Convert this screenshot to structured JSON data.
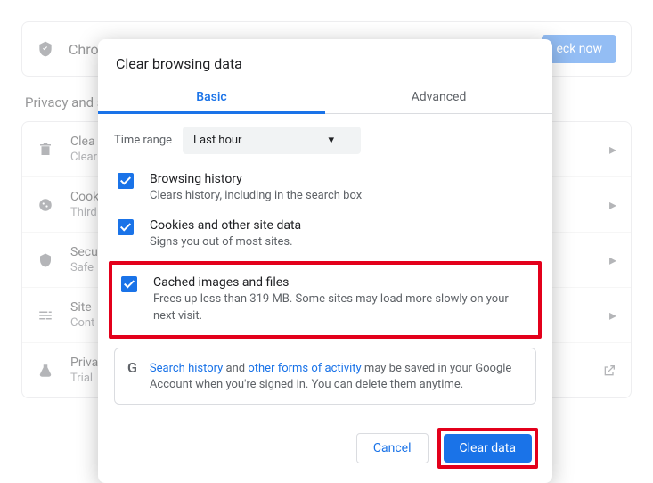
{
  "background": {
    "banner_text": "Chro",
    "check_now": "eck now",
    "section": "Privacy and s",
    "rows": [
      {
        "label": "Clea",
        "sub": "Clear"
      },
      {
        "label": "Cook",
        "sub": "Third"
      },
      {
        "label": "Secu",
        "sub": "Safe"
      },
      {
        "label": "Site",
        "sub": "Cont"
      },
      {
        "label": "Priva",
        "sub": "Trial"
      }
    ]
  },
  "dialog": {
    "title": "Clear browsing data",
    "tabs": {
      "basic": "Basic",
      "advanced": "Advanced"
    },
    "time_range_label": "Time range",
    "time_range_value": "Last hour",
    "options": [
      {
        "label": "Browsing history",
        "sub": "Clears history, including in the search box"
      },
      {
        "label": "Cookies and other site data",
        "sub": "Signs you out of most sites."
      },
      {
        "label": "Cached images and files",
        "sub": "Frees up less than 319 MB. Some sites may load more slowly on your next visit."
      }
    ],
    "info_prefix": "",
    "info_link1": "Search history",
    "info_mid": " and ",
    "info_link2": "other forms of activity",
    "info_suffix": " may be saved in your Google Account when you're signed in. You can delete them anytime.",
    "cancel": "Cancel",
    "clear": "Clear data"
  }
}
